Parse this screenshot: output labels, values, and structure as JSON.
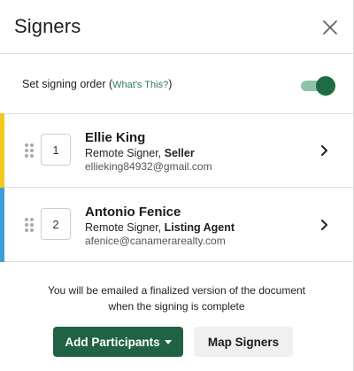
{
  "header": {
    "title": "Signers",
    "close_icon": "close-icon"
  },
  "signing_order": {
    "label": "Set signing order",
    "open_paren": " (",
    "link": "What's This?",
    "close_paren": ")",
    "enabled": true,
    "toggle_on_color": "#1f6b45"
  },
  "signers": [
    {
      "order": "1",
      "name": "Ellie King",
      "type": "Remote Signer, ",
      "role": "Seller",
      "email": "ellieking84932@gmail.com",
      "accent": "#f2c81c"
    },
    {
      "order": "2",
      "name": "Antonio Fenice",
      "type": "Remote Signer, ",
      "role": "Listing Agent",
      "email": "afenice@canamerarealty.com",
      "accent": "#3d9ed6"
    }
  ],
  "footer": {
    "note_line1": "You will be emailed a finalized version of the document",
    "note_line2": "when the signing is complete",
    "add_label": "Add Participants",
    "map_label": "Map Signers",
    "primary_color": "#1f6244"
  }
}
